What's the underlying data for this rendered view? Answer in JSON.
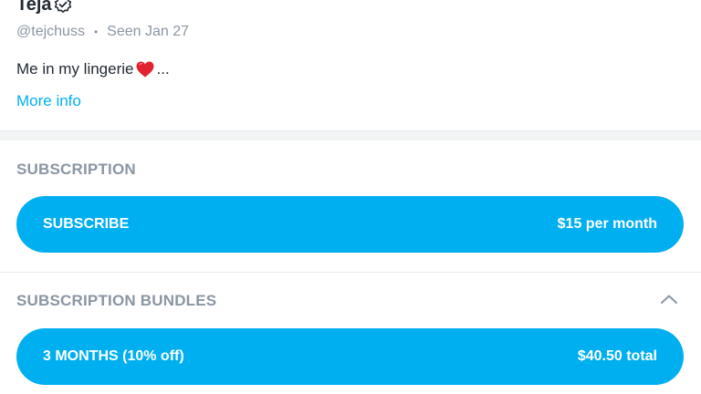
{
  "profile": {
    "name": "Teja",
    "handle": "@tejchuss",
    "separator": "•",
    "last_seen": "Seen Jan 27",
    "bio_text": "Me in my lingerie",
    "bio_ellipsis": "...",
    "more_info_label": "More info",
    "verified_icon": "verified-check-icon",
    "heart_icon": "red-heart-icon"
  },
  "subscription": {
    "section_title": "SUBSCRIPTION",
    "button_label": "SUBSCRIBE",
    "price_text": "$15 per month"
  },
  "bundles": {
    "section_title": "SUBSCRIPTION BUNDLES",
    "toggle_icon": "chevron-up-icon",
    "items": [
      {
        "label": "3 MONTHS (10% off)",
        "price": "$40.50 total"
      }
    ]
  },
  "colors": {
    "accent": "#00aff0",
    "text_primary": "#222a33",
    "text_muted": "#8a96a3",
    "heart": "#e0242f"
  }
}
